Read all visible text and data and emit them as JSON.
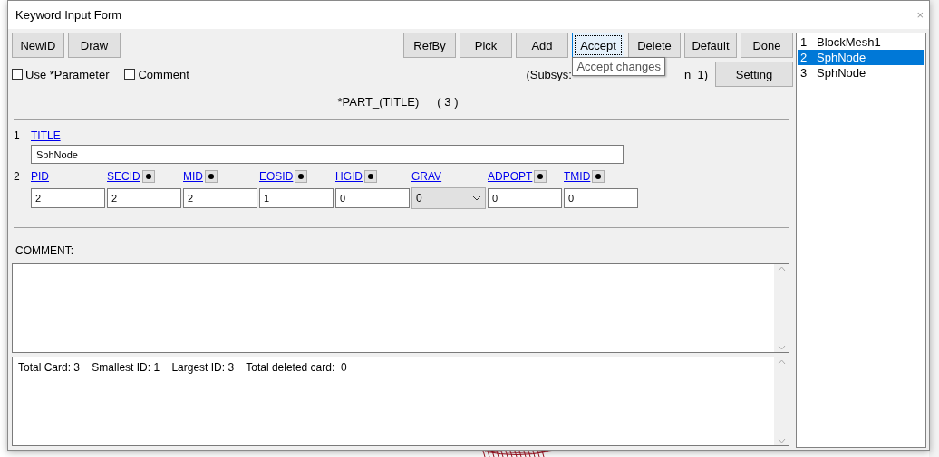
{
  "window": {
    "title": "Keyword Input Form",
    "close": "×"
  },
  "toolbar_left": [
    {
      "label": "NewID",
      "focused": false
    },
    {
      "label": "Draw",
      "focused": false
    }
  ],
  "toolbar_right": [
    {
      "label": "RefBy",
      "focused": false
    },
    {
      "label": "Pick",
      "focused": false
    },
    {
      "label": "Add",
      "focused": false
    },
    {
      "label": "Accept",
      "focused": true
    },
    {
      "label": "Delete",
      "focused": false
    },
    {
      "label": "Default",
      "focused": false
    },
    {
      "label": "Done",
      "focused": false
    }
  ],
  "options": [
    {
      "label": "Use *Parameter",
      "checked": false
    },
    {
      "label": "Comment",
      "checked": false
    }
  ],
  "subsys": {
    "before": "(Subsys:",
    "after": "n_1)"
  },
  "tooltip": "Accept changes",
  "setting_button": "Setting",
  "keyword": {
    "name": "*PART_(TITLE)",
    "count": "( 3 )"
  },
  "card1": {
    "number": "1",
    "label": "TITLE",
    "value": "SphNode"
  },
  "card2": {
    "number": "2",
    "fields": [
      {
        "label": "PID",
        "kind": "text",
        "has_pick": false,
        "value": "2"
      },
      {
        "label": "SECID",
        "kind": "text",
        "has_pick": true,
        "value": "2"
      },
      {
        "label": "MID",
        "kind": "text",
        "has_pick": true,
        "value": "2"
      },
      {
        "label": "EOSID",
        "kind": "text",
        "has_pick": true,
        "value": "1"
      },
      {
        "label": "HGID",
        "kind": "text",
        "has_pick": true,
        "value": "0"
      },
      {
        "label": "GRAV",
        "kind": "dropdown",
        "has_pick": false,
        "value": "0"
      },
      {
        "label": "ADPOPT",
        "kind": "text",
        "has_pick": true,
        "value": "0"
      },
      {
        "label": "TMID",
        "kind": "text",
        "has_pick": true,
        "value": "0"
      }
    ]
  },
  "comment_label": "COMMENT:",
  "info": "Total Card: 3    Smallest ID: 1    Largest ID: 3    Total deleted card:  0",
  "list": [
    {
      "number": "1",
      "name": "BlockMesh1",
      "selected": false
    },
    {
      "number": "2",
      "name": "SphNode",
      "selected": true
    },
    {
      "number": "3",
      "name": "SphNode",
      "selected": false
    }
  ]
}
